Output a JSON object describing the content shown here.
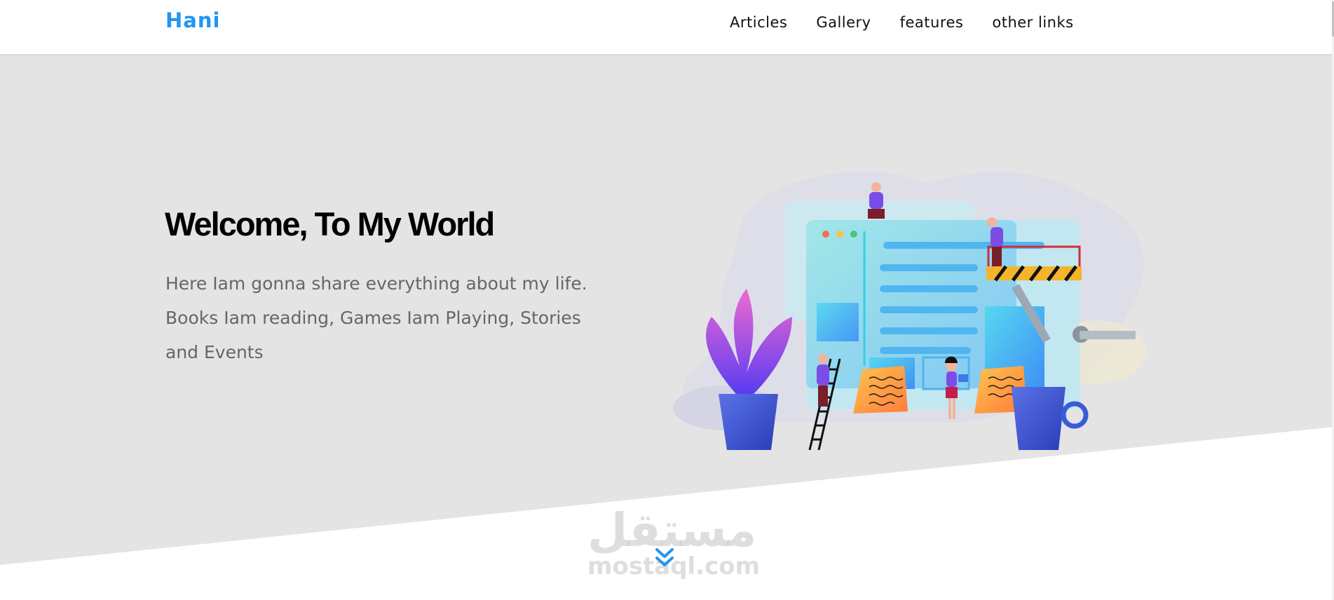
{
  "header": {
    "logo": "Hani",
    "nav": [
      {
        "label": "Articles"
      },
      {
        "label": "Gallery"
      },
      {
        "label": "features"
      },
      {
        "label": "other links"
      }
    ]
  },
  "landing": {
    "title": "Welcome, To My World",
    "text": "Here Iam gonna share everything about my life. Books Iam reading, Games Iam Playing, Stories and Events"
  },
  "watermark": {
    "arabic": "مستقل",
    "latin": "mostaql.com"
  },
  "colors": {
    "accent": "#2196f3",
    "landing_bg": "#e4e4e4",
    "header_bg": "#ffffff"
  },
  "icons": {
    "go_down": "double-chevron-down-icon"
  }
}
